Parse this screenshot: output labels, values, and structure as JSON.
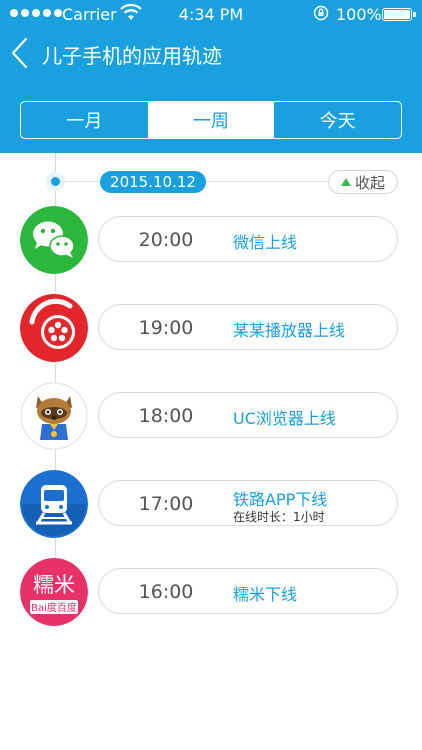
{
  "status_bar": {
    "carrier": "Carrier",
    "time": "4:34 PM",
    "battery": "100%"
  },
  "nav": {
    "title": "儿子手机的应用轨迹"
  },
  "tabs": [
    {
      "label": "一月",
      "active": false
    },
    {
      "label": "一周",
      "active": true
    },
    {
      "label": "今天",
      "active": false
    }
  ],
  "timeline": {
    "date": "2015.10.12",
    "collapse_label": "收起"
  },
  "entries": [
    {
      "app": "wechat-icon",
      "time": "20:00",
      "event": "微信上线",
      "detail": ""
    },
    {
      "app": "video-player-icon",
      "time": "19:00",
      "event": "某某播放器上线",
      "detail": ""
    },
    {
      "app": "uc-browser-icon",
      "time": "18:00",
      "event": "UC浏览器上线",
      "detail": ""
    },
    {
      "app": "railway-app-icon",
      "time": "17:00",
      "event": "铁路APP下线",
      "detail": "在线时长：1小时"
    },
    {
      "app": "nuomi-icon",
      "time": "16:00",
      "event": "糯米下线",
      "detail": "",
      "icon_text": "糯米",
      "icon_brand": "Bai度百度"
    }
  ],
  "colors": {
    "primary": "#1aa0df",
    "wechat": "#2bb73c",
    "player": "#e3262b",
    "railway": "#1a6fcf",
    "nuomi": "#e8306a"
  }
}
